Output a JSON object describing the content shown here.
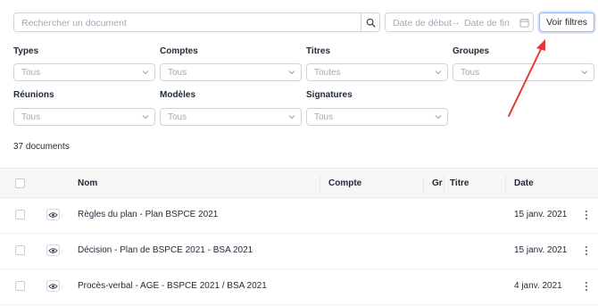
{
  "search": {
    "placeholder": "Rechercher un document"
  },
  "date_range": {
    "start_placeholder": "Date de début",
    "arrow": "→",
    "end_placeholder": "Date de fin"
  },
  "filters_button": {
    "label": "Voir filtres"
  },
  "filters": {
    "types": {
      "label": "Types",
      "value": "Tous"
    },
    "comptes": {
      "label": "Comptes",
      "value": "Tous"
    },
    "titres": {
      "label": "Titres",
      "value": "Toutes"
    },
    "groupes": {
      "label": "Groupes",
      "value": "Tous"
    },
    "reunions": {
      "label": "Réunions",
      "value": "Tous"
    },
    "modeles": {
      "label": "Modèles",
      "value": "Tous"
    },
    "signatures": {
      "label": "Signatures",
      "value": "Tous"
    }
  },
  "document_count": "37 documents",
  "table": {
    "headers": {
      "nom": "Nom",
      "compte": "Compte",
      "groupe": "Gr",
      "titre": "Titre",
      "date": "Date"
    },
    "rows": [
      {
        "nom": "Règles du plan - Plan BSPCE 2021",
        "compte": "",
        "titre": "",
        "date": "15 janv. 2021"
      },
      {
        "nom": "Décision - Plan de BSPCE 2021 - BSA 2021",
        "compte": "",
        "titre": "",
        "date": "15 janv. 2021"
      },
      {
        "nom": "Procès-verbal - AGE - BSPCE 2021 / BSA 2021",
        "compte": "",
        "titre": "",
        "date": "4 janv. 2021"
      }
    ]
  },
  "colors": {
    "annotation_arrow": "#e53935",
    "button_focus": "#93b4e8",
    "header_bg": "#f7f7f8"
  },
  "icons": [
    "search-icon",
    "calendar-icon",
    "chevron-down-icon",
    "eye-icon",
    "more-vertical-icon",
    "annotation-arrow"
  ]
}
